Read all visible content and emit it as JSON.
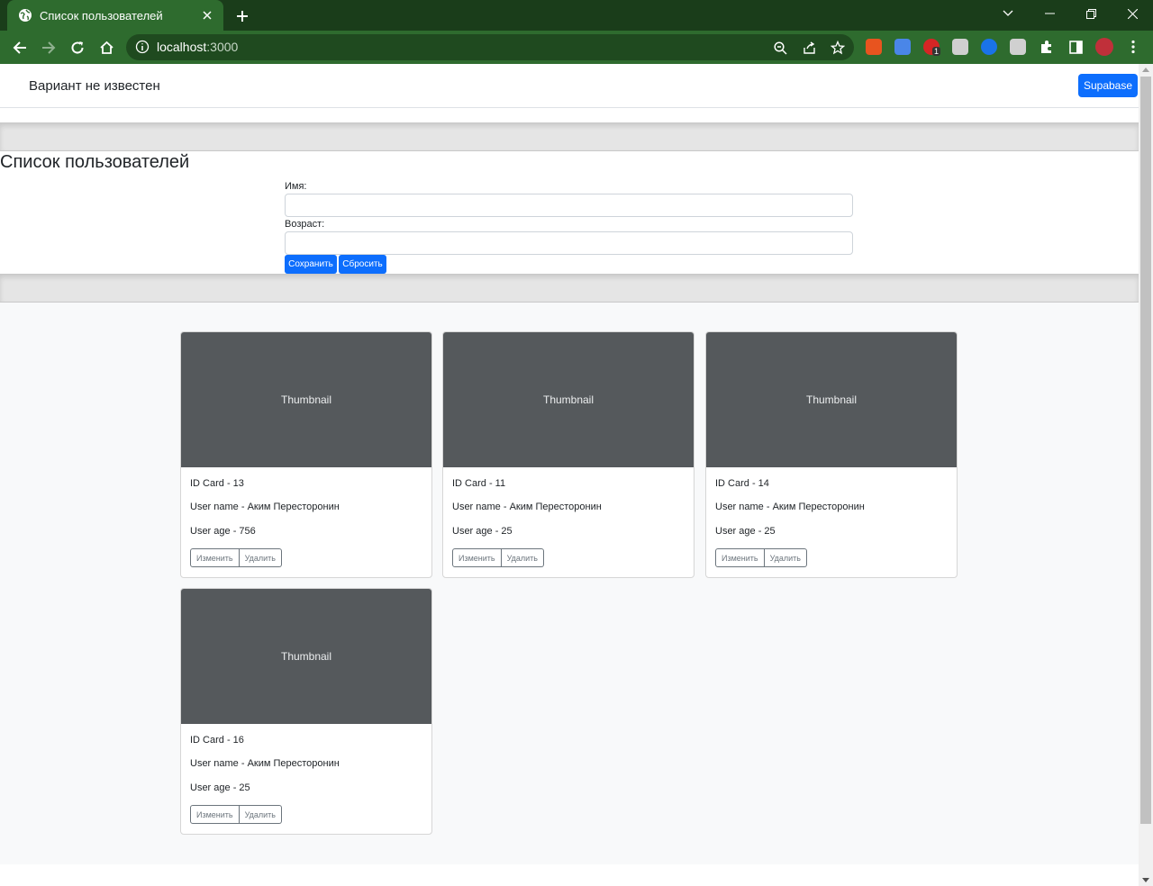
{
  "browser": {
    "tab_title": "Список пользователей",
    "url_host": "localhost",
    "url_port": ":3000",
    "extension_badge": "1"
  },
  "navbar": {
    "brand": "Вариант не известен",
    "supabase_button": "Supabase"
  },
  "page": {
    "title": "Список пользователей",
    "form": {
      "name_label": "Имя:",
      "name_value": "",
      "age_label": "Возраст:",
      "age_value": "",
      "save_button": "Сохранить",
      "reset_button": "Сбросить"
    }
  },
  "cards": [
    {
      "thumbnail": "Thumbnail",
      "id_line": "ID Card - 13",
      "name_line": "User name - Аким Пересторонин",
      "age_line": "User age - 756",
      "edit": "Изменить",
      "delete": "Удалить"
    },
    {
      "thumbnail": "Thumbnail",
      "id_line": "ID Card - 11",
      "name_line": "User name - Аким Пересторонин",
      "age_line": "User age - 25",
      "edit": "Изменить",
      "delete": "Удалить"
    },
    {
      "thumbnail": "Thumbnail",
      "id_line": "ID Card - 14",
      "name_line": "User name - Аким Пересторонин",
      "age_line": "User age - 25",
      "edit": "Изменить",
      "delete": "Удалить"
    },
    {
      "thumbnail": "Thumbnail",
      "id_line": "ID Card - 16",
      "name_line": "User name - Аким Пересторонин",
      "age_line": "User age - 25",
      "edit": "Изменить",
      "delete": "Удалить"
    }
  ],
  "colors": {
    "chrome_dark": "#1a3d1a",
    "chrome_tab": "#2e6b2e",
    "primary": "#0d6efd",
    "thumbnail": "#55595c"
  },
  "icons": [
    "globe-icon",
    "close-icon",
    "plus-icon",
    "back-icon",
    "forward-icon",
    "reload-icon",
    "home-icon",
    "info-icon",
    "zoom-icon",
    "share-icon",
    "star-icon",
    "puzzle-icon",
    "sidepanel-icon",
    "menu-icon"
  ]
}
